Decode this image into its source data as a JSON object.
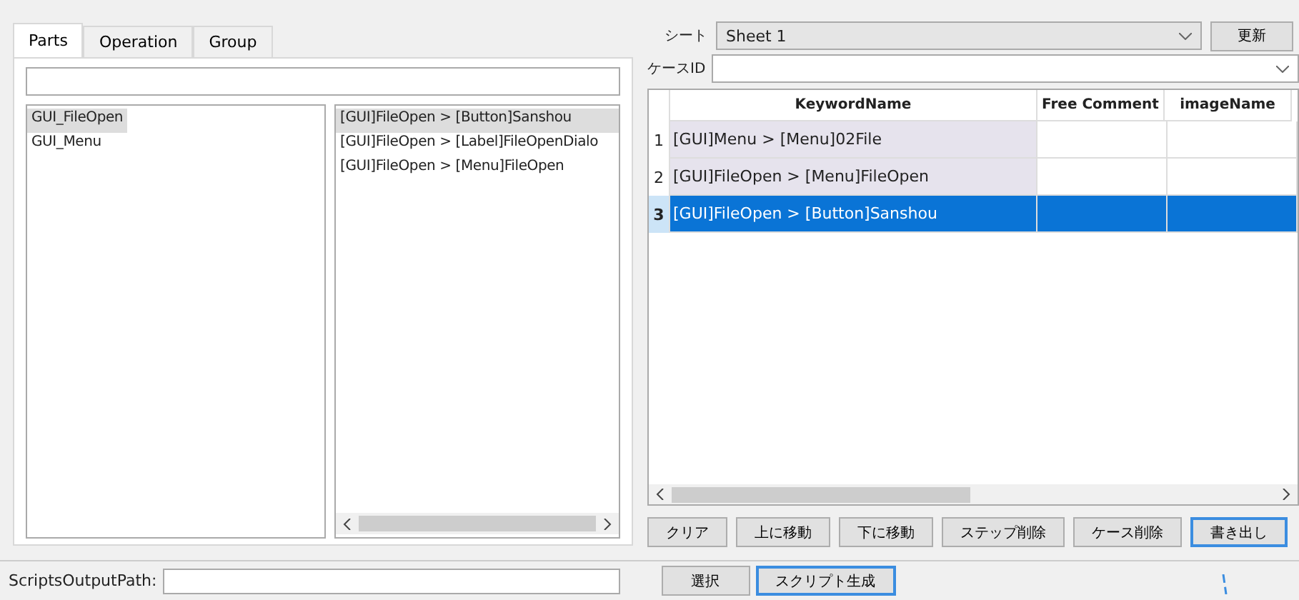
{
  "tabs": [
    {
      "label": "Parts",
      "selected": true
    },
    {
      "label": "Operation",
      "selected": false
    },
    {
      "label": "Group",
      "selected": false
    }
  ],
  "parts_list": [
    {
      "label": "GUI_FileOpen",
      "selected": true
    },
    {
      "label": "GUI_Menu",
      "selected": false
    }
  ],
  "elements_list": [
    {
      "label": "[GUI]FileOpen > [Button]Sanshou",
      "selected": true
    },
    {
      "label": "[GUI]FileOpen > [Label]FileOpenDialo",
      "selected": false
    },
    {
      "label": "[GUI]FileOpen > [Menu]FileOpen",
      "selected": false
    }
  ],
  "sheet": {
    "label": "シート",
    "value": "Sheet 1",
    "refresh_button": "更新"
  },
  "case_id": {
    "label": "ケースID"
  },
  "table": {
    "columns": [
      "KeywordName",
      "Free Comment",
      "imageName"
    ],
    "rows": [
      {
        "index": "1",
        "keyword": "[GUI]Menu > [Menu]02File",
        "selected": false
      },
      {
        "index": "2",
        "keyword": "[GUI]FileOpen > [Menu]FileOpen",
        "selected": false
      },
      {
        "index": "3",
        "keyword": "[GUI]FileOpen > [Button]Sanshou",
        "selected": true
      }
    ]
  },
  "buttons": [
    {
      "label": "クリア",
      "highlighted": false
    },
    {
      "label": "上に移動",
      "highlighted": false
    },
    {
      "label": "下に移動",
      "highlighted": false
    },
    {
      "label": "ステップ削除",
      "highlighted": false
    },
    {
      "label": "ケース削除",
      "highlighted": false
    },
    {
      "label": "書き出し",
      "highlighted": true
    }
  ],
  "output": {
    "label": "ScriptsOutputPath:",
    "select_button": "選択",
    "generate_button": "スクリプト生成",
    "generate_highlighted": true
  }
}
